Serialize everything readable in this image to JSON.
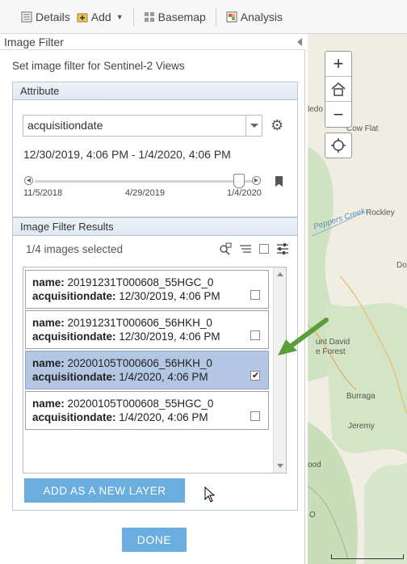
{
  "toolbar": {
    "details": "Details",
    "add": "Add",
    "basemap": "Basemap",
    "analysis": "Analysis"
  },
  "panel": {
    "title": "Image Filter",
    "subtitle": "Set image filter for Sentinel-2 Views"
  },
  "attribute": {
    "header": "Attribute",
    "field_value": "acquisitiondate",
    "date_range": "12/30/2019, 4:06 PM - 1/4/2020, 4:06 PM",
    "slider_min_label": "11/5/2018",
    "slider_mid_label": "4/29/2019",
    "slider_max_label": "1/4/2020",
    "slider_position_fraction": 0.93
  },
  "results": {
    "header": "Image Filter Results",
    "count_text": "1/4 images selected",
    "items": [
      {
        "name_label": "name:",
        "name": "20191231T000608_55HGC_0",
        "date_label": "acquisitiondate:",
        "date": "12/30/2019, 4:06 PM",
        "checked": false
      },
      {
        "name_label": "name:",
        "name": "20191231T000606_56HKH_0",
        "date_label": "acquisitiondate:",
        "date": "12/30/2019, 4:06 PM",
        "checked": false
      },
      {
        "name_label": "name:",
        "name": "20200105T000606_56HKH_0",
        "date_label": "acquisitiondate:",
        "date": "1/4/2020, 4:06 PM",
        "checked": true
      },
      {
        "name_label": "name:",
        "name": "20200105T000608_55HGC_0",
        "date_label": "acquisitiondate:",
        "date": "1/4/2020, 4:06 PM",
        "checked": false
      }
    ],
    "add_layer_button": "ADD AS A NEW LAYER"
  },
  "done_button": "DONE",
  "map": {
    "labels": {
      "a": "ledo",
      "b": "Cow Flat",
      "c": "Peppers Creek",
      "d": "Rockley",
      "e": "Do",
      "f": "unt David",
      "g": "e Forest",
      "h": "Burraga",
      "i": "Jeremy",
      "j": "ood",
      "k": "O"
    }
  },
  "colors": {
    "accent": "#6aaee0",
    "selected_row": "#b3c6e3",
    "annotation_arrow": "#5a9e3a"
  }
}
